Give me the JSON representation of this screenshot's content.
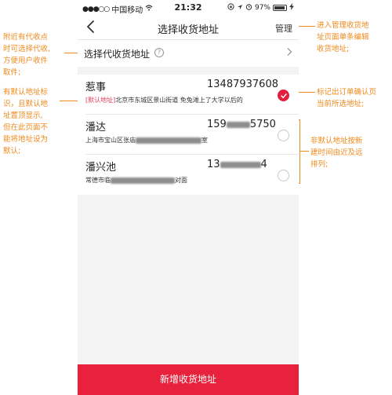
{
  "status_bar": {
    "signal": "●●●○○",
    "carrier": "中国移动",
    "time": "21:32",
    "battery": "97%"
  },
  "nav": {
    "title": "选择收货地址",
    "manage_label": "管理"
  },
  "agent_row": {
    "label": "选择代收货地址",
    "help_glyph": "?"
  },
  "addresses": [
    {
      "name": "惹事",
      "phone": "13487937608",
      "default_tag": "[默认地址]",
      "detail": "北京市东城区景山街道 免兔滩上了大学以后的",
      "selected": true
    },
    {
      "name": "潘达",
      "phone_prefix": "159",
      "phone_suffix": "5750",
      "detail_prefix": "上海市宝山区张庙",
      "detail_suffix": "室",
      "selected": false
    },
    {
      "name": "潘兴池",
      "phone_prefix": "13",
      "phone_suffix": "4",
      "detail_prefix": "常德市临",
      "detail_suffix": "对面",
      "selected": false
    }
  ],
  "add_button_label": "新增收货地址",
  "annotations": {
    "left_top": [
      "附近有代收点",
      "时可选择代收,",
      "方便用户收件",
      "取件;"
    ],
    "left_mid": [
      "有默认地址标",
      "识，且默认地",
      "址置顶显示,",
      "但在此页面不",
      "能将地址设为",
      "默认;"
    ],
    "right_top": [
      "进入管理收货地",
      "址页面单条编辑",
      "收货地址;"
    ],
    "right_mid": [
      "标记出订单确认页",
      "当前所选地址;"
    ],
    "right_low": [
      "非默认地址按新",
      "建时间由近及远",
      "排列;"
    ]
  },
  "colors": {
    "accent": "#e31f3d",
    "annotation": "#f08a1d",
    "default_tag": "#e63c5a"
  }
}
